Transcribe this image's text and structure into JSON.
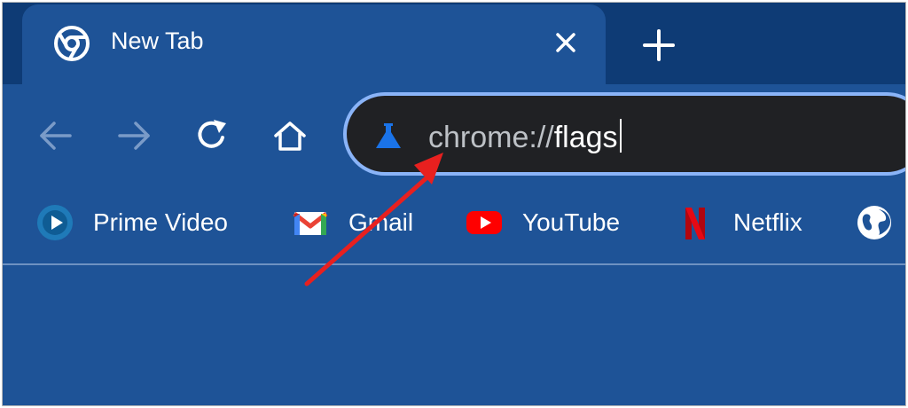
{
  "tab": {
    "title": "New Tab",
    "close_icon": "close-icon",
    "favicon": "chrome-icon"
  },
  "newtab_icon": "plus-icon",
  "nav": {
    "back_icon": "back-arrow-icon",
    "forward_icon": "forward-arrow-icon",
    "reload_icon": "reload-icon",
    "home_icon": "home-icon"
  },
  "omnibox": {
    "prefix": "chrome://",
    "value": "flags",
    "icon": "flask-icon"
  },
  "bookmarks": [
    {
      "label": "Prime Video",
      "icon": "prime-video-icon"
    },
    {
      "label": "Gmail",
      "icon": "gmail-icon"
    },
    {
      "label": "YouTube",
      "icon": "youtube-icon"
    },
    {
      "label": "Netflix",
      "icon": "netflix-icon"
    },
    {
      "label": "",
      "icon": "globe-icon"
    }
  ],
  "annotation": {
    "arrow_color": "#e8201f"
  },
  "colors": {
    "frame": "#1e5397",
    "tabstrip": "#0e3b75",
    "omnibox": "#202124",
    "focus_ring": "#8ab4f8"
  }
}
